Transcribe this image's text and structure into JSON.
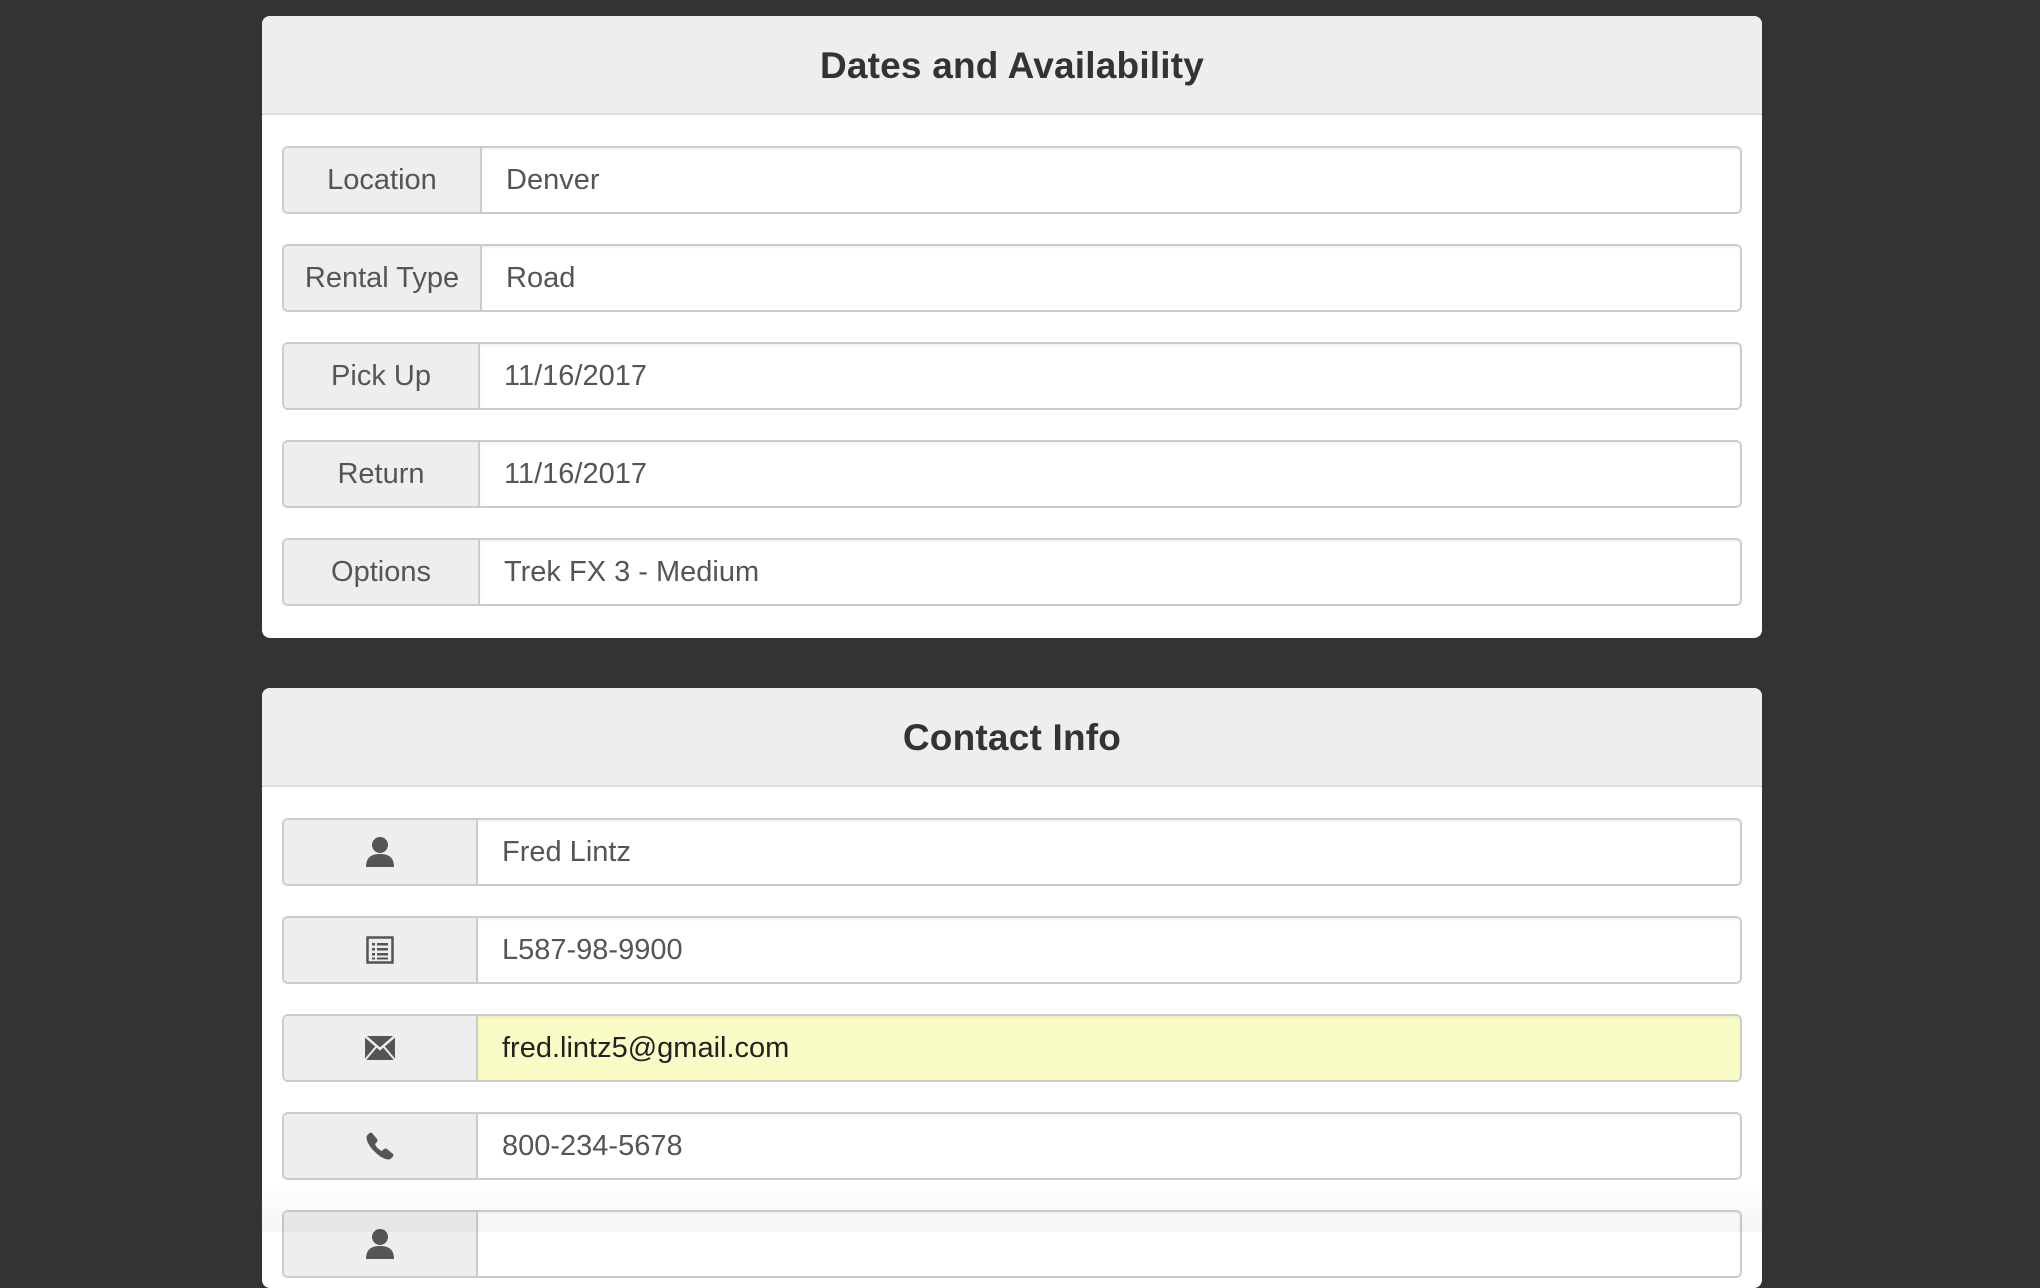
{
  "dates_panel": {
    "title": "Dates and Availability",
    "rows": [
      {
        "label": "Location",
        "value": "Denver"
      },
      {
        "label": "Rental Type",
        "value": "Road"
      },
      {
        "label": "Pick Up",
        "value": "11/16/2017"
      },
      {
        "label": "Return",
        "value": "11/16/2017"
      },
      {
        "label": "Options",
        "value": "Trek FX 3 - Medium"
      }
    ]
  },
  "contact_panel": {
    "title": "Contact Info",
    "rows": [
      {
        "icon": "user-icon",
        "value": "Fred Lintz"
      },
      {
        "icon": "list-alt-icon",
        "value": "L587-98-9900"
      },
      {
        "icon": "envelope-icon",
        "value": "fred.lintz5@gmail.com"
      },
      {
        "icon": "phone-icon",
        "value": "800-234-5678"
      },
      {
        "icon": "user-icon",
        "value": ""
      }
    ]
  },
  "colors": {
    "page_background": "#333333",
    "panel_heading": "#eeeeee",
    "autofill_highlight": "#fafcc6"
  }
}
